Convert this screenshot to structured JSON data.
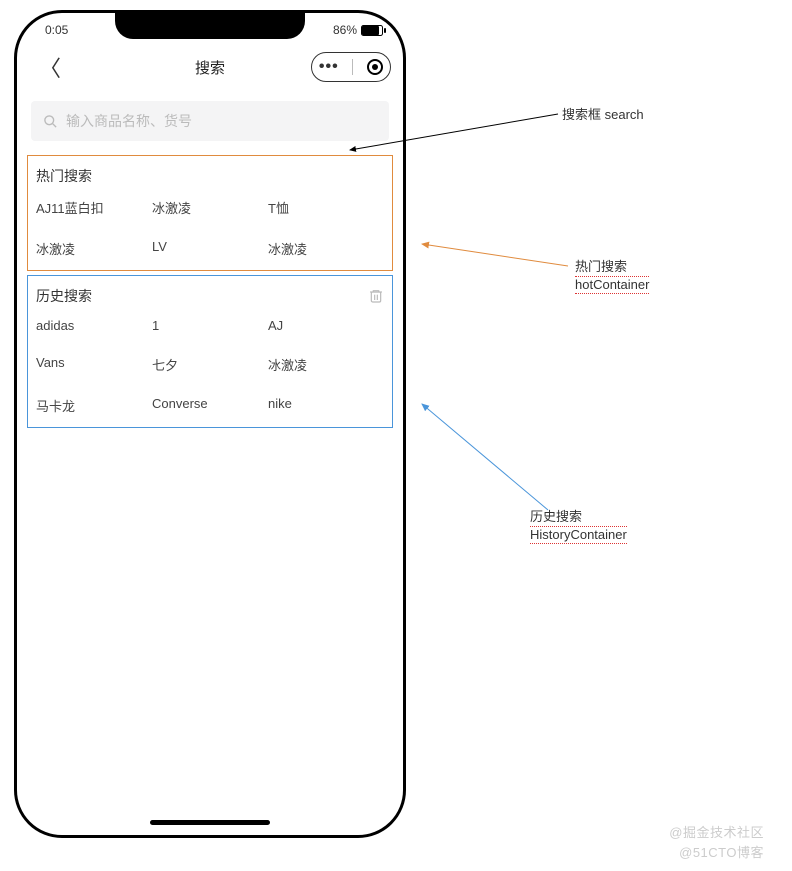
{
  "status": {
    "time": "0:05",
    "battery_percent": "86%"
  },
  "nav": {
    "title": "搜索"
  },
  "search": {
    "placeholder": "输入商品名称、货号"
  },
  "hot": {
    "title": "热门搜索",
    "items": [
      "AJ11蓝白扣",
      "冰激凌",
      "T恤",
      "冰激凌",
      "LV",
      "冰激凌"
    ]
  },
  "history": {
    "title": "历史搜索",
    "items": [
      "adidas",
      "1",
      "AJ",
      "Vans",
      "七夕",
      "冰激凌",
      "马卡龙",
      "Converse",
      "nike"
    ]
  },
  "annotations": {
    "search_label": "搜索框 search",
    "hot_label_line1": "热门搜索",
    "hot_label_line2": "hotContainer",
    "hist_label_line1": "历史搜索",
    "hist_label_line2": "HistoryContainer"
  },
  "watermark": {
    "line1": "@掘金技术社区",
    "line2": "@51CTO博客"
  }
}
